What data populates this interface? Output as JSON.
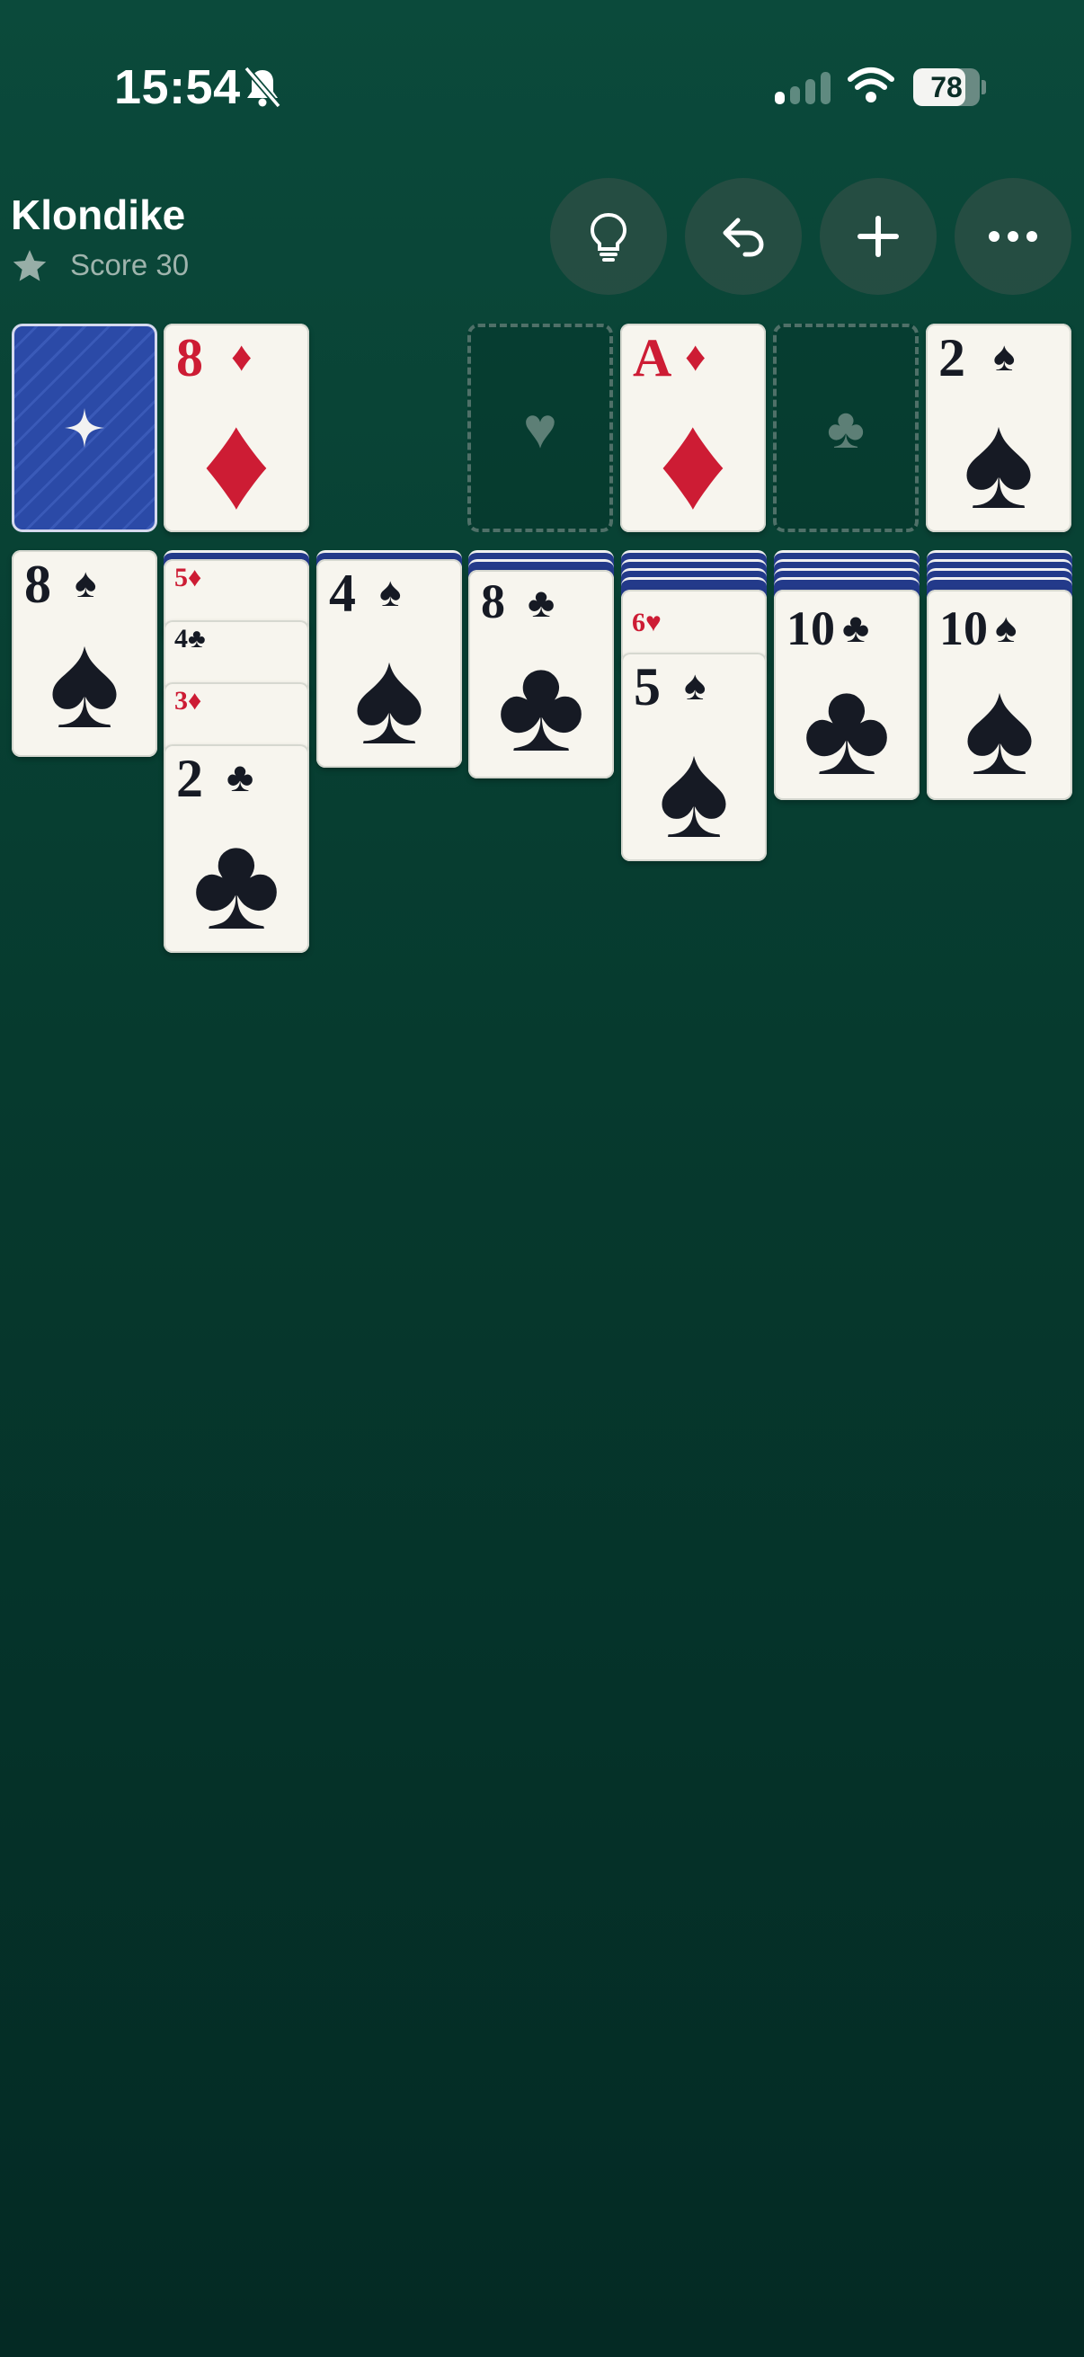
{
  "status_bar": {
    "time": "15:54",
    "battery": "78",
    "battery_level": 0.78
  },
  "header": {
    "title": "Klondike",
    "score": "Score 30"
  },
  "toolbar": {
    "hint_icon": "lightbulb-icon",
    "undo_icon": "undo-icon",
    "new_game_icon": "plus-icon",
    "more_icon": "more-dots-icon"
  },
  "stock": {
    "icon": "sparkle-icon"
  },
  "waste": {
    "rank": "8",
    "suit": "♦"
  },
  "foundations": [
    {
      "placeholder_suit": "♥"
    },
    {
      "rank": "A",
      "suit": "♦"
    },
    {
      "placeholder_suit": "♣"
    },
    {
      "rank": "2",
      "suit": "♠"
    }
  ],
  "tableau": [
    {
      "top": {
        "rank": "8",
        "suit": "♠"
      }
    },
    {
      "stacked": [
        {
          "rank": "5",
          "suit": "♦"
        },
        {
          "rank": "4",
          "suit": "♣"
        },
        {
          "rank": "3",
          "suit": "♦"
        }
      ],
      "top": {
        "rank": "2",
        "suit": "♣"
      }
    },
    {
      "top": {
        "rank": "4",
        "suit": "♠"
      }
    },
    {
      "top": {
        "rank": "8",
        "suit": "♣"
      }
    },
    {
      "stacked": [
        {
          "rank": "6",
          "suit": "♥"
        }
      ],
      "top": {
        "rank": "5",
        "suit": "♠"
      }
    },
    {
      "top": {
        "rank": "10",
        "suit": "♣"
      }
    },
    {
      "top": {
        "rank": "10",
        "suit": "♠"
      }
    }
  ],
  "colors": {
    "felt": "#0b4a3b",
    "card_face": "#f7f5ee",
    "red_suit": "#cd1c34",
    "black_suit": "#161a24",
    "card_back": "#2b4aa7"
  }
}
